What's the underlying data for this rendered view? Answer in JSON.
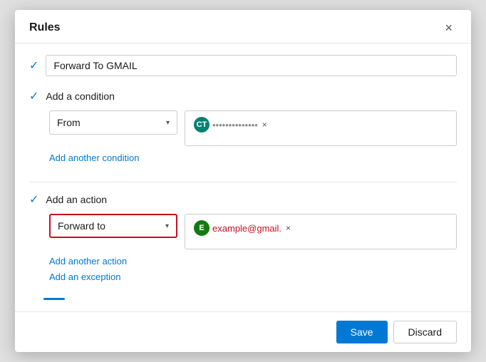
{
  "dialog": {
    "title": "Rules",
    "close_label": "×"
  },
  "rule_name": {
    "value": "Forward To GMAIL",
    "placeholder": "Rule name"
  },
  "condition_section": {
    "label": "Add a condition",
    "dropdown_value": "From",
    "tag_avatar_initials": "CT",
    "tag_avatar_color": "teal",
    "tag_text": "••••••••••••••",
    "remove_label": "×",
    "add_link": "Add another condition"
  },
  "action_section": {
    "label": "Add an action",
    "dropdown_value": "Forward to",
    "tag_avatar_initials": "E",
    "tag_avatar_color": "green",
    "tag_text": "example@gmail.",
    "tag_text_color": "red",
    "remove_label": "×",
    "add_action_link": "Add another action",
    "add_exception_link": "Add an exception"
  },
  "footer": {
    "save_label": "Save",
    "discard_label": "Discard"
  }
}
